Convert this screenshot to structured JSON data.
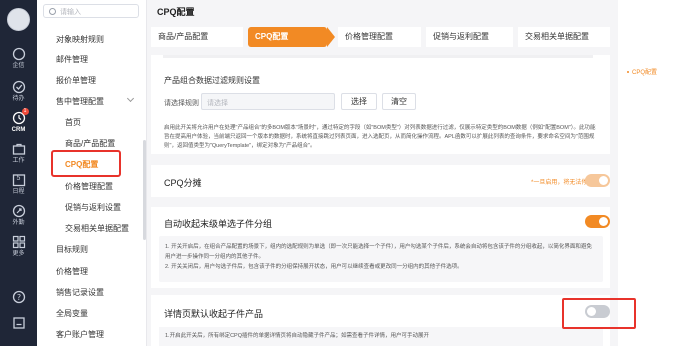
{
  "rail": {
    "items": [
      {
        "label": "企信",
        "icon": "chat-icon"
      },
      {
        "label": "待办",
        "icon": "check-circle-icon"
      },
      {
        "label": "CRM",
        "icon": "clock-icon",
        "badge": "1"
      },
      {
        "label": "工作",
        "icon": "briefcase-icon"
      },
      {
        "label": "日程",
        "icon": "calendar-icon",
        "calendar_day": "5"
      },
      {
        "label": "外勤",
        "icon": "location-icon"
      },
      {
        "label": "更多",
        "icon": "grid-icon"
      }
    ],
    "bottom_icons": [
      "help-icon",
      "settings-icon"
    ]
  },
  "search": {
    "placeholder": "请输入"
  },
  "menu": {
    "items": [
      "对象映射规则",
      "邮件管理",
      "报价单管理",
      "售中管理配置",
      "首页",
      "商品/产品配置",
      "CPQ配置",
      "价格管理配置",
      "促销与返利设置",
      "交易相关单据配置",
      "目标规则",
      "价格管理",
      "销售记录设置",
      "全局变量",
      "客户账户管理"
    ]
  },
  "page": {
    "title": "CPQ配置"
  },
  "tabs": [
    "商品/产品配置",
    "CPQ配置",
    "价格管理配置",
    "促销与返利配置",
    "交易相关单据配置"
  ],
  "right_nav": {
    "label": "CPQ配置"
  },
  "filter_section": {
    "title": "产品组合数据过滤规则设置",
    "rule_label": "请选择规则",
    "rule_placeholder": "请选择",
    "select_button": "选择",
    "clear_button": "清空",
    "description": "启用此开关将允许用户在处理\"产品组合\"的多BOM版本\"场景时\"，通过特定的字段（如\"BOM类型\"）对列表数据进行过滤，仅展示特定类型的BOM数据（例如\"配置BOM\"）。此功能旨在提高用户体验，当前端只返回一个版本的数据时，系统将直接跳过列表页面，进入选配页，从而简化操作流程。APL函数可以扩展此列表的查询条件，要求命名空间为\"范围规则\"，返回值类型为\"QueryTemplate\"，绑定对象为\"产品组合\"。"
  },
  "cpq_section": {
    "title": "CPQ分摊",
    "hint": "*一旦启用，将无法停用",
    "toggle_state": "on-disabled"
  },
  "collapse_section": {
    "title": "自动收起末级单选子件分组",
    "toggle_state": "on",
    "note_line1": "1. 开关开启后，在组合产品配置的场景下，组内的选配规则为单选（即一次只能选择一个子件），用户勾选某个子件后，系统会自动将包含该子件的分组收起，以简化界面和避免用户进一步操作同一分组内的其他子件。",
    "note_line2": "2. 开关关闭后，用户勾选子件后，包含该子件的分组保持展开状态，用户可以继续查看或更改同一分组内的其他子件选项。"
  },
  "detail_section": {
    "title": "详情页默认收起子件产品",
    "toggle_state": "off",
    "note_line1": "1.开启此开关后，所有绑定CPQ插件的单据详情页将自动隐藏子件产品；如需查看子件详情，用户可手动展开"
  }
}
